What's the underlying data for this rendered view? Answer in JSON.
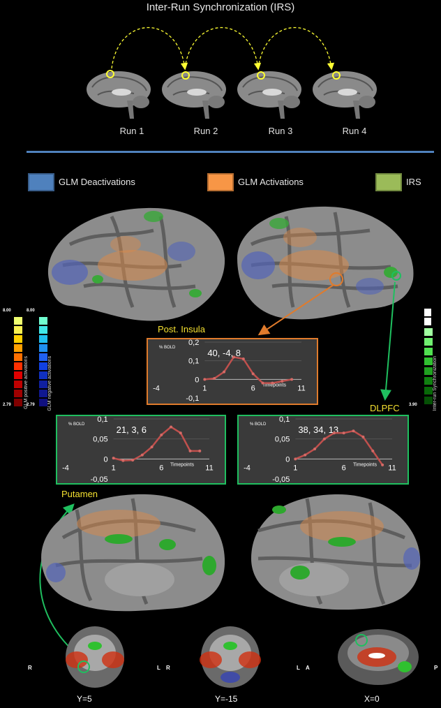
{
  "title": "Inter-Run Synchronization (IRS)",
  "runs": [
    "Run 1",
    "Run 2",
    "Run 3",
    "Run 4"
  ],
  "legend": [
    {
      "label": "GLM Deactivations",
      "color": "#4f81bd"
    },
    {
      "label": "GLM Activations",
      "color": "#f79646"
    },
    {
      "label": "IRS",
      "color": "#9bbb59"
    }
  ],
  "scales": {
    "positive": {
      "max": "8.00",
      "min": "2.79",
      "label": "GLM positive activations"
    },
    "negative": {
      "max": "8.00",
      "min": "2.79",
      "label": "GLM negative activations"
    },
    "irs": {
      "min": "3.90",
      "label": "Inter-run Synchronization"
    }
  },
  "roi_labels": {
    "insula": "Post. Insula",
    "dlpfc": "DLPFC",
    "putamen": "Putamen"
  },
  "chart_data": [
    {
      "type": "line",
      "ylabel": "% BOLD",
      "xlabel": "Timepoints",
      "annotation": "40, -4, 8",
      "x": [
        1,
        2,
        3,
        4,
        5,
        6,
        7,
        8,
        9,
        10
      ],
      "values": [
        0,
        0.005,
        0.04,
        0.12,
        0.11,
        0.03,
        -0.02,
        -0.02,
        -0.01,
        0.0
      ],
      "xlim": [
        -4,
        11
      ],
      "ylim": [
        -0.1,
        0.2
      ],
      "xticks": [
        "-4",
        "1",
        "6",
        "11"
      ],
      "yticks": [
        "0,2",
        "0,1",
        "0",
        "-0,1"
      ],
      "color": "#c0504d"
    },
    {
      "type": "line",
      "ylabel": "% BOLD",
      "xlabel": "Timepoints",
      "annotation": "21, 3, 6",
      "x": [
        1,
        2,
        3,
        4,
        5,
        6,
        7,
        8,
        9,
        10
      ],
      "values": [
        0.002,
        -0.004,
        -0.003,
        0.01,
        0.03,
        0.06,
        0.08,
        0.065,
        0.02,
        0.02
      ],
      "xlim": [
        -4,
        11
      ],
      "ylim": [
        -0.05,
        0.1
      ],
      "xticks": [
        "-4",
        "1",
        "6",
        "11"
      ],
      "yticks": [
        "0,1",
        "0,05",
        "0",
        "-0,05"
      ],
      "color": "#c0504d"
    },
    {
      "type": "line",
      "ylabel": "% BOLD",
      "xlabel": "Timepoints",
      "annotation": "38, 34, 13",
      "x": [
        1,
        2,
        3,
        4,
        5,
        6,
        7,
        8,
        9,
        10
      ],
      "values": [
        0.0,
        0.01,
        0.025,
        0.05,
        0.065,
        0.065,
        0.07,
        0.055,
        0.02,
        -0.015
      ],
      "xlim": [
        -4,
        11
      ],
      "ylim": [
        -0.05,
        0.1
      ],
      "xticks": [
        "-4",
        "1",
        "6",
        "11"
      ],
      "yticks": [
        "0,1",
        "0,05",
        "0",
        "-0,05"
      ],
      "color": "#c0504d"
    }
  ],
  "slices": [
    {
      "label": "Y=5",
      "left": "R",
      "right": "L"
    },
    {
      "label": "Y=-15",
      "left": "R",
      "right": "L"
    },
    {
      "label": "X=0",
      "left": "A",
      "right": "P"
    }
  ]
}
